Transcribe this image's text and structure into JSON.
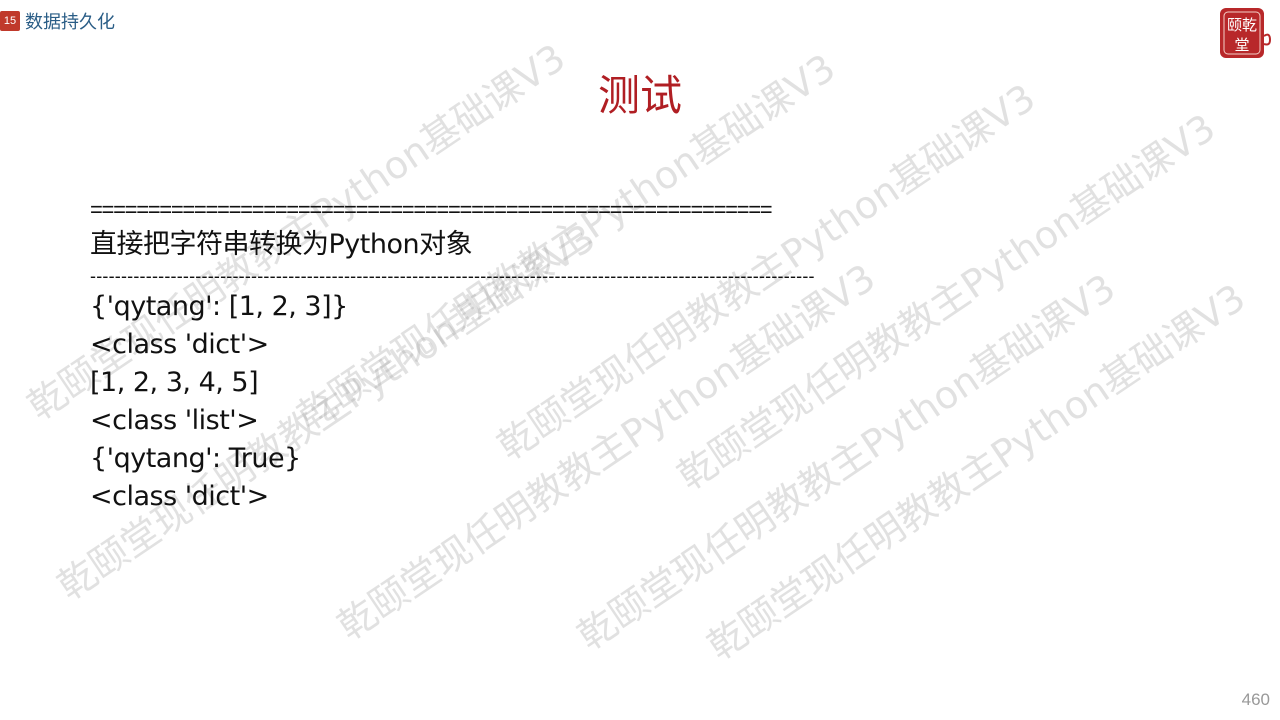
{
  "header": {
    "section_number": "15",
    "section_title": "数据持久化"
  },
  "logo": {
    "icon": "seal-logo-icon",
    "text": "乾颐堂"
  },
  "title": "测试",
  "content": {
    "separator_equals": "===========================================================",
    "heading": "直接把字符串转换为Python对象",
    "separator_dashes": "---------------------------------------------------------------------------------------------------------------------",
    "output_lines": [
      "{'qytang': [1, 2, 3]}",
      "<class 'dict'>",
      "[1, 2, 3, 4, 5]",
      "<class 'list'>",
      "{'qytang': True}",
      "<class 'dict'>"
    ]
  },
  "watermark": {
    "text_a": "乾颐堂现任明教教主Python基础课V3"
  },
  "page_number": "460",
  "colors": {
    "title": "#b01e23",
    "section_title": "#2a5d86",
    "badge": "#c0392b"
  }
}
